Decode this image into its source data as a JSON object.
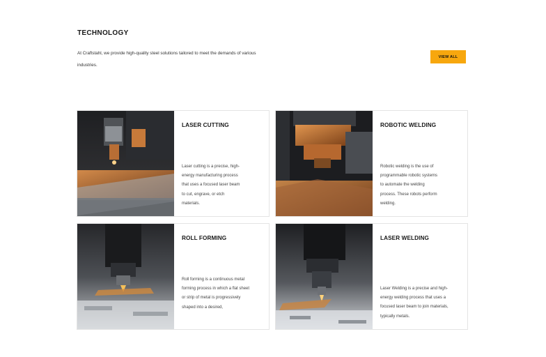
{
  "section": {
    "title": "TECHNOLOGY",
    "intro_line1": "At Craftstahl, we provide high-quality steel solutions tailored to meet the demands of various",
    "intro_line2": "industries.",
    "button_label": "VIEW ALL"
  },
  "colors": {
    "accent": "#f7a70e",
    "copper": "#c9773a"
  },
  "cards": [
    {
      "title": "LASER CUTTING",
      "image_icon": "laser-cutting-image",
      "lines": [
        "Laser cutting is a precise, high-",
        "energy manufacturing process",
        "that uses a focused laser beam",
        "to cut, engrave, or etch",
        "materials."
      ]
    },
    {
      "title": "ROBOTIC WELDING",
      "image_icon": "robotic-welding-image",
      "lines": [
        "Robotic welding is the use of",
        "programmable robotic systems",
        "to automate the welding",
        "process. These robots perform",
        "welding."
      ]
    },
    {
      "title": "ROLL FORMING",
      "image_icon": "roll-forming-image",
      "lines": [
        "Roll forming is a continuous metal",
        "forming process in which a flat sheet",
        "or strip of metal is progressively",
        "shaped into a desired,"
      ]
    },
    {
      "title": "LASER WELDING",
      "image_icon": "laser-welding-image",
      "lines": [
        "Laser Welding is a precise and high-",
        "energy welding process that uses a",
        "focused laser beam to join materials,",
        "typically metals."
      ]
    }
  ]
}
